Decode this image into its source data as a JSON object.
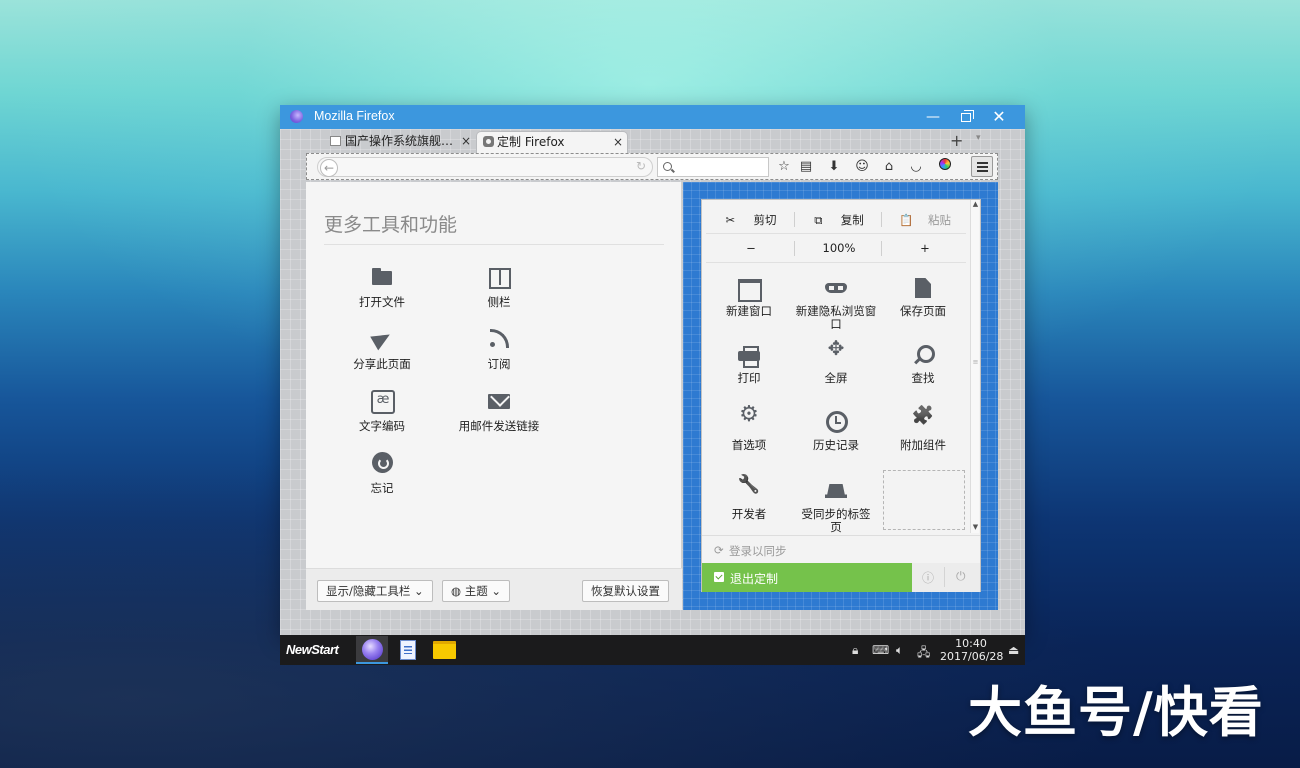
{
  "window": {
    "title": "Mozilla Firefox",
    "controls": {
      "minimize": "—",
      "close": "✕"
    }
  },
  "tabs": [
    {
      "label": "国产操作系统旗舰…",
      "close": "×"
    },
    {
      "label": "定制 Firefox",
      "close": "×"
    }
  ],
  "tabstrip": {
    "new_tab": "+",
    "list": "▾"
  },
  "navbar": {
    "back": "←",
    "reload": "↻",
    "search_placeholder": "",
    "icons": [
      "bookmark-star-icon",
      "reading-list-icon",
      "download-icon",
      "emoji-icon",
      "home-icon",
      "pocket-icon",
      "color-icon",
      "menu-icon"
    ]
  },
  "palette": {
    "title": "更多工具和功能",
    "items": [
      {
        "label": "打开文件",
        "icon": "folder-icon"
      },
      {
        "label": "侧栏",
        "icon": "sidebar-icon"
      },
      {
        "label": "分享此页面",
        "icon": "share-icon"
      },
      {
        "label": "订阅",
        "icon": "rss-icon"
      },
      {
        "label": "文字编码",
        "icon": "encoding-icon"
      },
      {
        "label": "用邮件发送链接",
        "icon": "mail-icon"
      },
      {
        "label": "忘记",
        "icon": "forget-icon"
      }
    ],
    "footer": {
      "toolbars": "显示/隐藏工具栏",
      "themes": "主题",
      "restore": "恢复默认设置"
    }
  },
  "menu_panel": {
    "edit": {
      "cut": "剪切",
      "copy": "复制",
      "paste": "粘贴"
    },
    "zoom": {
      "minus": "−",
      "level": "100%",
      "plus": "+"
    },
    "items": [
      {
        "label": "新建窗口",
        "icon": "window-icon"
      },
      {
        "label": "新建隐私浏览窗口",
        "icon": "private-mask-icon"
      },
      {
        "label": "保存页面",
        "icon": "save-page-icon"
      },
      {
        "label": "打印",
        "icon": "print-icon"
      },
      {
        "label": "全屏",
        "icon": "fullscreen-icon"
      },
      {
        "label": "查找",
        "icon": "find-icon"
      },
      {
        "label": "首选项",
        "icon": "gear-icon"
      },
      {
        "label": "历史记录",
        "icon": "history-icon"
      },
      {
        "label": "附加组件",
        "icon": "addons-puzzle-icon"
      },
      {
        "label": "开发者",
        "icon": "wrench-icon"
      },
      {
        "label": "受同步的标签页",
        "icon": "synced-tabs-icon"
      }
    ],
    "signin": "登录以同步",
    "exit": "退出定制"
  },
  "taskbar": {
    "start_label": "NewStart",
    "time": "10:40",
    "date": "2017/06/28"
  },
  "watermark": "大鱼号/快看",
  "colors": {
    "titlebar": "#3c97de",
    "exit_green": "#75c24b",
    "customize_blue": "#2e7ad1"
  }
}
